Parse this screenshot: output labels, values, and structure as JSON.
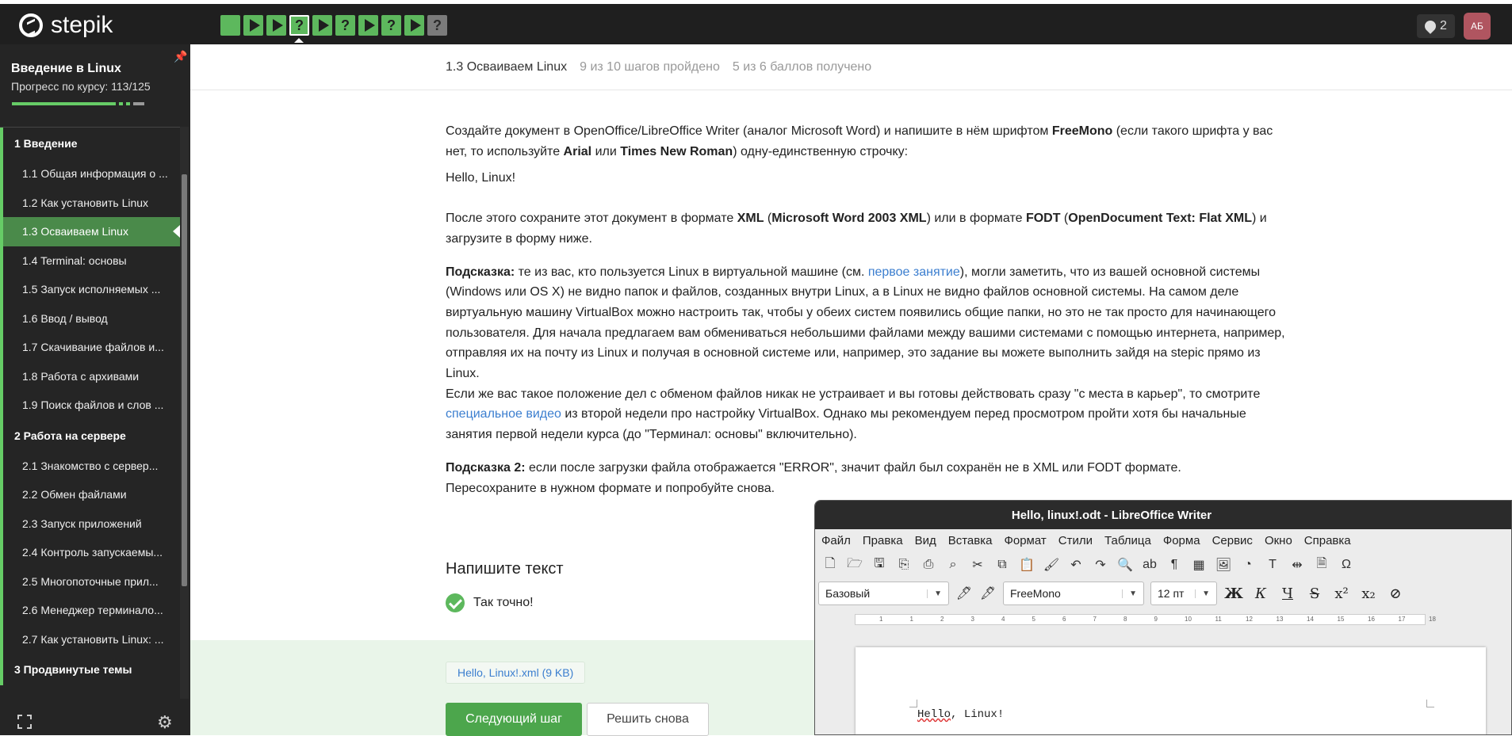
{
  "topbar": {
    "logo_text": "stepik",
    "steps": [
      {
        "type": "square",
        "status": "passed"
      },
      {
        "type": "play",
        "status": "passed"
      },
      {
        "type": "play",
        "status": "passed"
      },
      {
        "type": "question",
        "status": "passed",
        "current": true
      },
      {
        "type": "play",
        "status": "passed"
      },
      {
        "type": "question",
        "status": "passed"
      },
      {
        "type": "play",
        "status": "passed"
      },
      {
        "type": "question",
        "status": "passed"
      },
      {
        "type": "play",
        "status": "passed"
      },
      {
        "type": "question",
        "status": "not_passed"
      }
    ],
    "notifications_count": "2",
    "avatar_initials": "АБ"
  },
  "sidebar": {
    "course_title": "Введение в Linux",
    "progress_label": "Прогресс по курсу:  113/125",
    "progress_value": 0.904,
    "modules": [
      {
        "title": "1  Введение",
        "lessons": [
          {
            "label": "1.1  Общая информация о ..."
          },
          {
            "label": "1.2  Как установить Linux"
          },
          {
            "label": "1.3  Осваиваем Linux",
            "active": true
          },
          {
            "label": "1.4  Terminal: основы"
          },
          {
            "label": "1.5  Запуск исполняемых ..."
          },
          {
            "label": "1.6  Ввод / вывод"
          },
          {
            "label": "1.7  Скачивание файлов и..."
          },
          {
            "label": "1.8  Работа с архивами"
          },
          {
            "label": "1.9  Поиск файлов и слов ..."
          }
        ]
      },
      {
        "title": "2  Работа на сервере",
        "lessons": [
          {
            "label": "2.1  Знакомство с сервер..."
          },
          {
            "label": "2.2  Обмен файлами"
          },
          {
            "label": "2.3  Запуск приложений"
          },
          {
            "label": "2.4  Контроль запускаемы..."
          },
          {
            "label": "2.5  Многопоточные прил..."
          },
          {
            "label": "2.6  Менеджер терминало..."
          },
          {
            "label": "2.7  Как установить Linux: ..."
          }
        ]
      },
      {
        "title": "3  Продвинутые темы",
        "lessons": []
      }
    ]
  },
  "header": {
    "lesson_name": "1.3 Осваиваем Linux",
    "steps_done": "9 из 10 шагов пройдено",
    "score": "5 из 6 баллов  получено"
  },
  "content": {
    "p1_a": "Создайте документ в OpenOffice/LibreOffice Writer (аналог Microsoft Word) и напишите в нём шрифтом ",
    "p1_font": "FreeMono",
    "p1_b": " (если такого шрифта у вас нет, то используйте ",
    "p1_arial": "Arial",
    "p1_or": " или ",
    "p1_tnr": "Times New Roman",
    "p1_c": ") одну-единственную строчку:",
    "hello": "Hello, Linux!",
    "p2_a": "После этого сохраните этот документ в формате ",
    "p2_xml": "XML",
    "p2_b": " (",
    "p2_msw": "Microsoft Word 2003 XML",
    "p2_c": ") или в формате ",
    "p2_fodt": "FODT",
    "p2_d": " (",
    "p2_odt": "OpenDocument Text: Flat XML",
    "p2_e": ") и загрузите в форму ниже.",
    "hint_label": "Подсказка:",
    "hint_a": " те из вас, кто пользуется Linux в виртуальной машине (см. ",
    "hint_link1": "первое занятие",
    "hint_b": "), могли заметить, что из вашей основной системы (Windows или OS X) не видно папок и файлов, созданных внутри Linux, а в Linux не видно файлов основной системы. На самом деле виртуальную машину VirtualBox можно настроить так, чтобы у обеих систем появились общие папки, но это не так просто для начинающего пользователя. Для начала предлагаем вам обмениваться небольшими файлами между вашими системами с помощью интернета, например, отправляя их на почту из Linux и получая в основной системе или, например, это задание вы можете выполнить зайдя на stepic прямо из Linux.",
    "hint_c": "Если же вас такое положение дел с обменом файлов никак не устраивает и вы готовы действовать сразу \"с места в карьер\", то смотрите ",
    "hint_link2": "специальное видео",
    "hint_d": " из второй недели про настройку VirtualBox. Однако мы рекомендуем перед просмотром пройти хотя бы начальные занятия первой недели курса (до \"Терминал: основы\" включительно).",
    "hint2_label": "Подсказка 2:",
    "hint2_a": " если после загрузки файла отображается \"ERROR\", значит файл был сохранён не в XML или FODT формате.",
    "hint2_b": "Пересохраните в нужном формате и попробуйте снова."
  },
  "answer": {
    "section_title": "Напишите текст",
    "result_text": "Так точно!",
    "file_label": "Hello, Linux!.xml (9 KB)",
    "next_button": "Следующий шаг",
    "retry_button": "Решить снова"
  },
  "libreoffice": {
    "title": "Hello, linux!.odt - LibreOffice Writer",
    "menu": [
      "Файл",
      "Правка",
      "Вид",
      "Вставка",
      "Формат",
      "Стили",
      "Таблица",
      "Форма",
      "Сервис",
      "Окно",
      "Справка"
    ],
    "style_value": "Базовый",
    "font_value": "FreeMono",
    "size_value": "12 пт",
    "bold": "Ж",
    "italic": "К",
    "underline": "Ч",
    "ruler_numbers": [
      "1",
      "1",
      "2",
      "3",
      "4",
      "5",
      "6",
      "7",
      "8",
      "9",
      "10",
      "11",
      "12",
      "13",
      "14",
      "15",
      "16",
      "17",
      "18"
    ],
    "doc_text_word1": "Hello",
    "doc_text_rest": ", Linux!"
  },
  "colors": {
    "accent_green": "#5db85d",
    "topbar": "#1f1f1f",
    "sidebar": "#252525",
    "link": "#3b7ecf"
  }
}
